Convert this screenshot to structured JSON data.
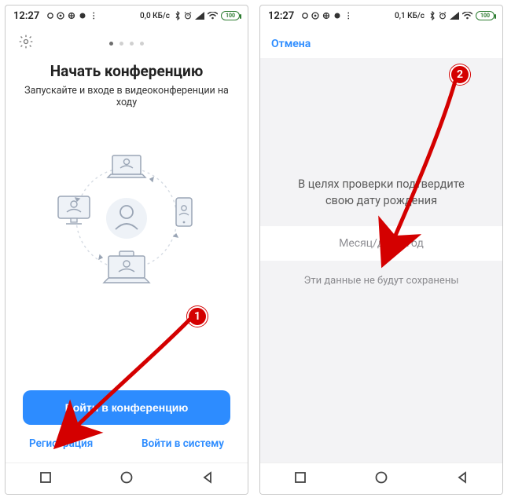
{
  "status": {
    "time": "12:27",
    "net_left_a": "0,0 КБ/с",
    "net_left_b": "0,1 КБ/с",
    "battery": "100"
  },
  "screen1": {
    "title": "Начать конференцию",
    "subtitle": "Запускайте и входе в видеоконференции на ходу",
    "join_label": "Войти в конференцию",
    "signup_label": "Регистрация",
    "signin_label": "Войти в систему"
  },
  "screen2": {
    "cancel_label": "Отмена",
    "prompt_line1": "В целях проверки подтвердите",
    "prompt_line2": "свою дату рождения",
    "dob_placeholder": "Месяц/день/год",
    "note": "Эти данные не будут сохранены"
  },
  "annotations": {
    "badge1": "1",
    "badge2": "2"
  }
}
